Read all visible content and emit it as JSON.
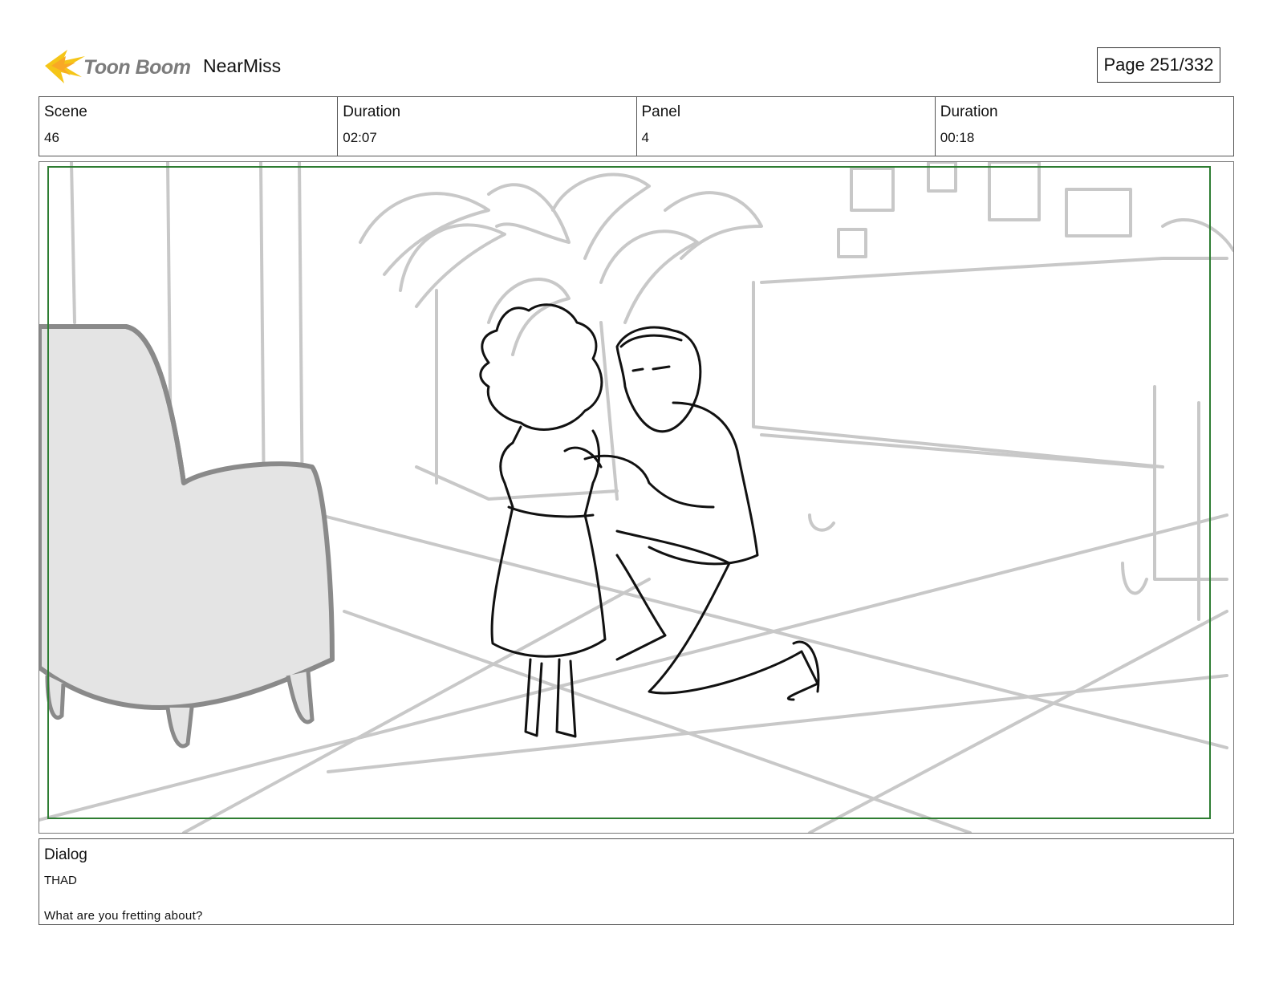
{
  "header": {
    "logo_text": "Toon Boom",
    "project_title": "NearMiss",
    "page_label": "Page 251/332"
  },
  "info": {
    "scene_label": "Scene",
    "scene_value": "46",
    "scene_duration_label": "Duration",
    "scene_duration_value": "02:07",
    "panel_label": "Panel",
    "panel_value": "4",
    "panel_duration_label": "Duration",
    "panel_duration_value": "00:18"
  },
  "dialog": {
    "label": "Dialog",
    "speaker": "THAD",
    "line": "What are you fretting about?"
  },
  "colors": {
    "safe_frame": "#2e7d32",
    "logo_flame": "#f5c518",
    "sketch_gray": "#c8c8c8",
    "sketch_dark": "#111111"
  }
}
